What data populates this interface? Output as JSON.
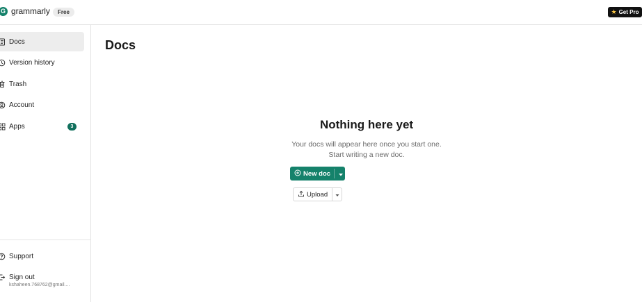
{
  "app": {
    "logo_letter": "G",
    "logo_text": "grammarly",
    "plan_badge": "Free",
    "get_pro_label": "Get Pro",
    "brand_color": "#15826b"
  },
  "sidebar": {
    "items": [
      {
        "label": "Docs",
        "icon": "document-icon",
        "active": true
      },
      {
        "label": "Version history",
        "icon": "history-icon"
      },
      {
        "label": "Trash",
        "icon": "trash-icon"
      },
      {
        "label": "Account",
        "icon": "account-icon"
      },
      {
        "label": "Apps",
        "icon": "apps-icon",
        "badge": "3"
      }
    ],
    "bottom": [
      {
        "label": "Support",
        "icon": "help-icon"
      },
      {
        "label": "Sign out",
        "icon": "signout-icon",
        "sub": "kshaheen.768762@gmail...."
      }
    ]
  },
  "main": {
    "title": "Docs",
    "empty_title": "Nothing here yet",
    "empty_line1": "Your docs will appear here once you start one.",
    "empty_line2": "Start writing a new doc.",
    "new_doc_label": "New doc",
    "upload_label": "Upload"
  }
}
